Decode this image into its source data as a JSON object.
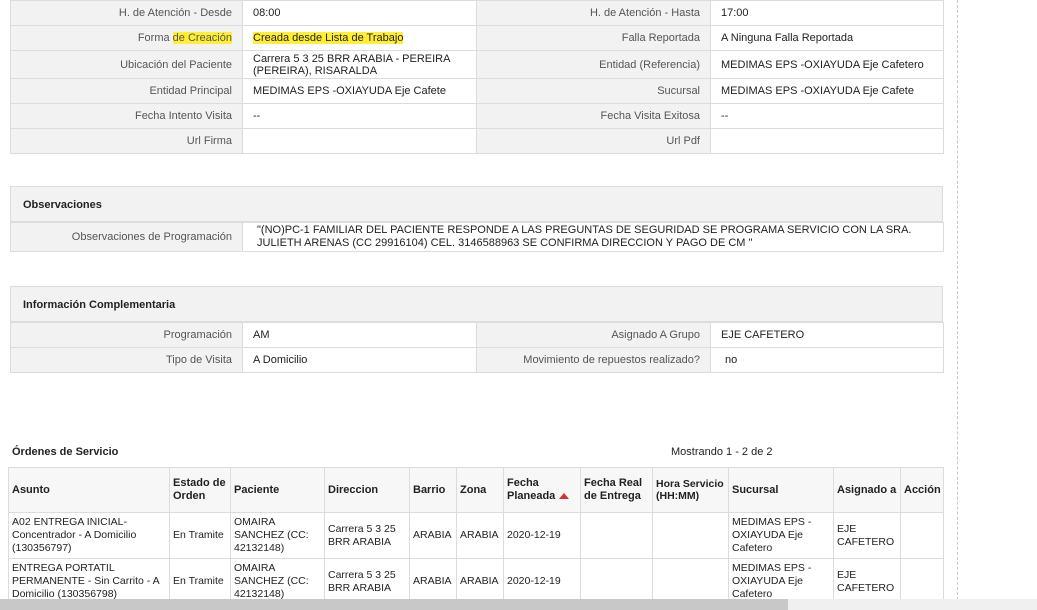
{
  "info_rows": [
    {
      "l1": "H. de Atención - Desde",
      "v1": "08:00",
      "l2": "H. de Atención - Hasta",
      "v2": "17:00"
    },
    {
      "l1a": "Forma ",
      "l1b": "de Creación",
      "v1": "Creada desde Lista de Trabajo",
      "l2": "Falla Reportada",
      "v2": "A Ninguna Falla Reportada"
    },
    {
      "l1": "Ubicación del Paciente",
      "v1": "Carrera 5 3 25 BRR ARABIA - PEREIRA (PEREIRA), RISARALDA",
      "l2": "Entidad (Referencia)",
      "v2": "MEDIMAS EPS -OXIAYUDA Eje Cafetero"
    },
    {
      "l1": "Entidad Principal",
      "v1": "MEDIMAS EPS -OXIAYUDA Eje Cafete",
      "l2": "Sucursal",
      "v2": "MEDIMAS EPS -OXIAYUDA Eje Cafete"
    },
    {
      "l1": "Fecha Intento Visita",
      "v1": "--",
      "l2": "Fecha Visita Exitosa",
      "v2": "--"
    },
    {
      "l1": "Url Firma",
      "v1": "",
      "l2": "Url Pdf",
      "v2": ""
    }
  ],
  "observaciones": {
    "title": "Observaciones",
    "label": "Observaciones de Programación",
    "value": "\"(NO)PC-1 FAMILIAR DEL PACIENTE RESPONDE A LAS PREGUNTAS DE SEGURIDAD SE PROGRAMA SERVICIO CON LA SRA. JULIETH ARENAS (CC 29916104) CEL. 3146588963 SE CONFIRMA DIRECCION Y PAGO DE CM \""
  },
  "complementaria": {
    "title": "Información Complementaria",
    "rows": [
      {
        "l1": "Programación",
        "v1": "AM",
        "l2": "Asignado A Grupo",
        "v2": "EJE CAFETERO"
      },
      {
        "l1": "Tipo de Visita",
        "v1": "A Domicilio",
        "l2": "Movimiento de repuestos realizado?",
        "v2": "no"
      }
    ]
  },
  "orders": {
    "title": "Órdenes de Servicio",
    "count": "Mostrando 1 - 2 de 2",
    "headers": [
      "Asunto",
      "Estado de Orden",
      "Paciente",
      "Direccion",
      "Barrio",
      "Zona",
      "Fecha Planeada",
      "Fecha Real de Entrega",
      "Hora Servicio (HH:MM)",
      "Sucursal",
      "Asignado a",
      "Acción"
    ],
    "rows": [
      {
        "asunto": "A02 ENTREGA INICIAL-Concentrador - A Domicilio (130356797)",
        "estado": "En Tramite",
        "paciente": "OMAIRA SANCHEZ (CC: 42132148)",
        "direccion": "Carrera 5 3 25 BRR ARABIA",
        "barrio": "ARABIA",
        "zona": "ARABIA",
        "fecha": "2020-12-19",
        "fecha_real": "",
        "hora": "",
        "sucursal": "MEDIMAS EPS -OXIAYUDA Eje Cafetero",
        "asignado": "EJE CAFETERO",
        "accion": ""
      },
      {
        "asunto": "ENTREGA PORTATIL PERMANENTE - Sin Carrito - A Domicilio (130356798)",
        "estado": "En Tramite",
        "paciente": "OMAIRA SANCHEZ (CC: 42132148)",
        "direccion": "Carrera 5 3 25 BRR ARABIA",
        "barrio": "ARABIA",
        "zona": "ARABIA",
        "fecha": "2020-12-19",
        "fecha_real": "",
        "hora": "",
        "sucursal": "MEDIMAS EPS -OXIAYUDA Eje Cafetero",
        "asignado": "EJE CAFETERO",
        "accion": ""
      }
    ]
  }
}
